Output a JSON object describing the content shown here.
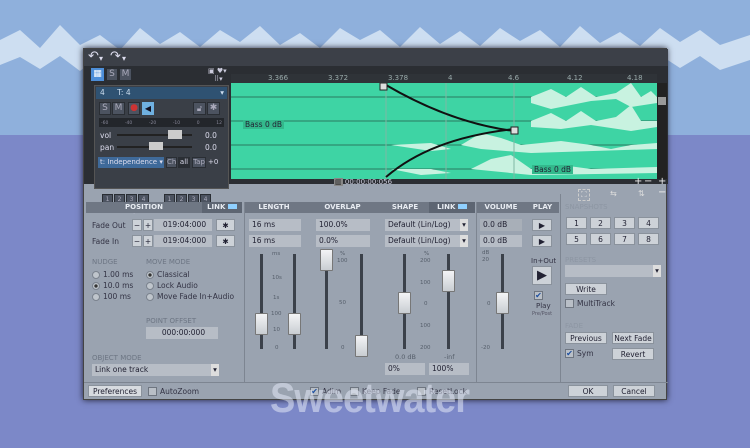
{
  "toolbar": {
    "undo_icon": "undo-icon",
    "redo_icon": "redo-icon"
  },
  "top_buttons": {
    "solo": "S",
    "mute": "M"
  },
  "ruler": [
    "3.366",
    "3.372",
    "3.378",
    "4",
    "4.6",
    "4.12",
    "4.18"
  ],
  "track": {
    "number": "4",
    "name": "T: 4",
    "solo": "S",
    "mute": "M",
    "meter_ticks": [
      "-60",
      "-40",
      "-20",
      "-10",
      "0",
      "12"
    ],
    "vol_label": "vol",
    "vol_value": "0.0",
    "pan_label": "pan",
    "pan_value": "0.0",
    "mode": "t: Independence",
    "ch": "Ch",
    "all": "all",
    "tap": "Tap",
    "tap_value": "+0"
  },
  "setup": {
    "buttons": [
      "1",
      "2",
      "3",
      "4"
    ],
    "label": "setup"
  },
  "zoom": {
    "buttons": [
      "1",
      "2",
      "3",
      "4"
    ],
    "label": "zoom"
  },
  "wave": {
    "label_left": "Bass  0 dB",
    "label_right": "Bass  0 dB",
    "color": "#3ed4a4"
  },
  "time_readout": "00:00:00:056",
  "position": {
    "header": "POSITION",
    "link": "LINK",
    "fade_out_label": "Fade Out",
    "fade_out_value": "019:04:000",
    "fade_in_label": "Fade In",
    "fade_in_value": "019:04:000",
    "minus": "−",
    "plus": "+"
  },
  "nudge": {
    "label": "NUDGE",
    "options": [
      "1.00 ms",
      "10.0 ms",
      "100 ms"
    ],
    "selected": 1
  },
  "move_mode": {
    "label": "MOVE MODE",
    "options": [
      "Classical",
      "Lock Audio",
      "Move Fade In+Audio"
    ],
    "selected": 0
  },
  "point_offset": {
    "label": "POINT OFFSET",
    "value": "000:00:000"
  },
  "object_mode": {
    "label": "OBJECT MODE",
    "value": "Link one track"
  },
  "length": {
    "header": "LENGTH",
    "out": "16 ms",
    "in": "16 ms",
    "unit": "ms",
    "ticks": [
      "10s",
      "1s",
      "100",
      "10",
      "0"
    ]
  },
  "overlap": {
    "header": "OVERLAP",
    "out": "100.0%",
    "in": "0.0%",
    "unit": "%",
    "ticks": [
      "100",
      "50",
      "0"
    ]
  },
  "shape": {
    "header": "SHAPE",
    "link": "LINK",
    "out": "Default  (Lin/Log)",
    "in": "Default  (Lin/Log)",
    "unit": "%",
    "ticks": [
      "200",
      "100",
      "0",
      "100",
      "200"
    ],
    "bottom_left": "0.0 dB",
    "bottom_right": "-inf",
    "field_left": "0%",
    "field_right": "100%"
  },
  "volume": {
    "header": "VOLUME",
    "out": "0.0 dB",
    "in": "0.0 dB",
    "unit": "dB",
    "ticks": [
      "20",
      "0",
      "-20"
    ]
  },
  "play": {
    "header": "PLAY",
    "in_out": "In+Out",
    "play_label": "Play",
    "play_sub": "Pre/Post",
    "play_checked": true
  },
  "snapshots": {
    "label": "SNAPSHOTS",
    "buttons": [
      "1",
      "2",
      "3",
      "4",
      "5",
      "6",
      "7",
      "8"
    ]
  },
  "presets": {
    "label": "PRESETS",
    "value": "",
    "write": "Write",
    "multitrack": "MultiTrack",
    "multitrack_checked": false
  },
  "fade": {
    "label": "FADE",
    "previous": "Previous",
    "next": "Next Fade",
    "sym": "Sym",
    "sym_checked": true,
    "revert": "Revert"
  },
  "footer": {
    "preferences": "Preferences",
    "autozoom": "AutoZoom",
    "autozoom_checked": false,
    "adim": "Adim",
    "adim_checked": true,
    "keep_fade": "Keep Fade",
    "keep_fade_checked": false,
    "reset_lock": "ResetLock",
    "reset_lock_checked": false,
    "ok": "OK",
    "cancel": "Cancel"
  },
  "watermark": "Sweetwater"
}
